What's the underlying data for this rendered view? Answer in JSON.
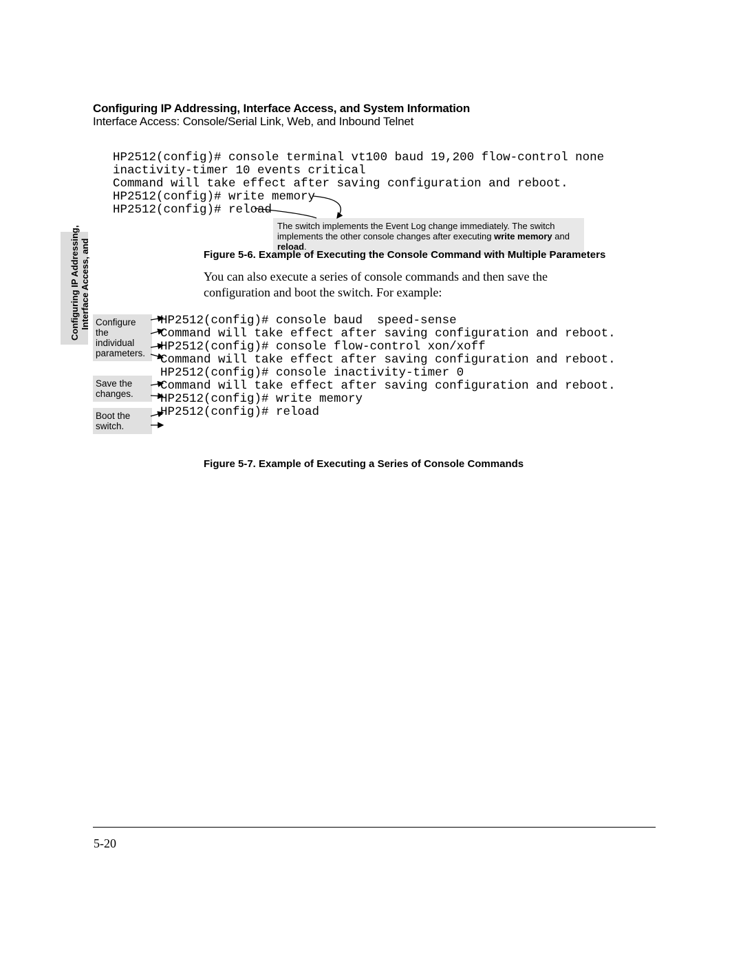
{
  "header": {
    "title": "Configuring IP Addressing, Interface Access, and System Information",
    "subtitle": "Interface Access: Console/Serial Link, Web, and Inbound Telnet"
  },
  "sidetab": {
    "line1": "Configuring IP Addressing,",
    "line2": "Interface Access, and"
  },
  "console1": {
    "l1": "HP2512(config)# console terminal vt100 baud 19,200 flow-control none",
    "l2": "inactivity-timer 10 events critical",
    "l3": "Command will take effect after saving configuration and reboot.",
    "l4": "HP2512(config)# write memory",
    "l5": "HP2512(config)# reload"
  },
  "note": {
    "pre": "The switch implements the Event Log change immediately. The switch implements the other console changes after executing ",
    "b1": "write memory",
    "mid": " and ",
    "b2": "reload",
    "post": "."
  },
  "fig6": "Figure 5-6.  Example of Executing the Console Command with Multiple Parameters",
  "body": "You can also execute a series of console commands and then save the configuration and boot the switch. For example:",
  "annos": {
    "a1": "Configure the individual parameters.",
    "a2": "Save the changes.",
    "a3": "Boot the switch."
  },
  "console2": {
    "l1": "HP2512(config)# console baud  speed-sense",
    "l2": "Command will take effect after saving configuration and reboot.",
    "l3": "HP2512(config)# console flow-control xon/xoff",
    "l4": "Command will take effect after saving configuration and reboot.",
    "l5": "HP2512(config)# console inactivity-timer 0",
    "l6": "Command will take effect after saving configuration and reboot.",
    "l7": "HP2512(config)# write memory",
    "l8": "HP2512(config)# reload"
  },
  "fig7": "Figure 5-7.  Example of Executing a Series of Console Commands",
  "page_number": "5-20"
}
